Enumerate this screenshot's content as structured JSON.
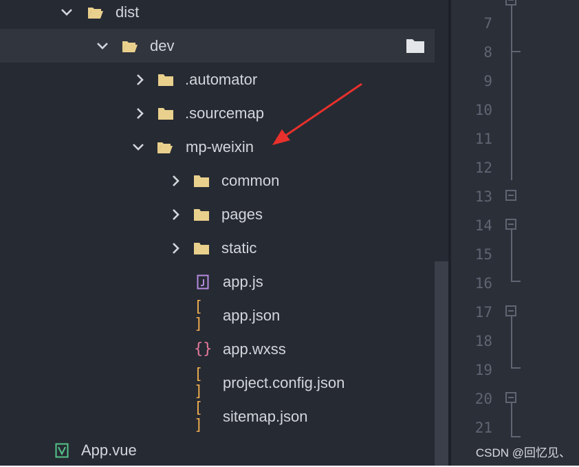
{
  "explorer": {
    "items": [
      {
        "label": "dist",
        "kind": "folder",
        "expanded": true
      },
      {
        "label": "dev",
        "kind": "folder",
        "expanded": true,
        "selected": true
      },
      {
        "label": ".automator",
        "kind": "folder",
        "expanded": false
      },
      {
        "label": ".sourcemap",
        "kind": "folder",
        "expanded": false
      },
      {
        "label": "mp-weixin",
        "kind": "folder",
        "expanded": true
      },
      {
        "label": "common",
        "kind": "folder",
        "expanded": false
      },
      {
        "label": "pages",
        "kind": "folder",
        "expanded": false
      },
      {
        "label": "static",
        "kind": "folder",
        "expanded": false
      },
      {
        "label": "app.js",
        "kind": "js-file"
      },
      {
        "label": "app.json",
        "kind": "json-file"
      },
      {
        "label": "app.wxss",
        "kind": "css-file"
      },
      {
        "label": "project.config.json",
        "kind": "json-file"
      },
      {
        "label": "sitemap.json",
        "kind": "json-file"
      },
      {
        "label": "App.vue",
        "kind": "vue-file"
      }
    ],
    "json_icon_text": "[ ]",
    "css_icon_text": "{}"
  },
  "gutter": {
    "line_numbers": [
      "7",
      "8",
      "9",
      "10",
      "11",
      "12",
      "13",
      "14",
      "15",
      "16",
      "17",
      "18",
      "19",
      "20",
      "21"
    ]
  },
  "watermark": "CSDN @回忆见、",
  "colors": {
    "panel_bg": "#262a33",
    "selected_row": "#31353e",
    "gutter_bg": "#2b2f38",
    "folder": "#e9d08c",
    "json_icon": "#e8a94f",
    "css_icon": "#e57a9c",
    "js_icon": "#b68be0",
    "vue_icon": "#56c48a",
    "arrow": "#e8312c"
  }
}
